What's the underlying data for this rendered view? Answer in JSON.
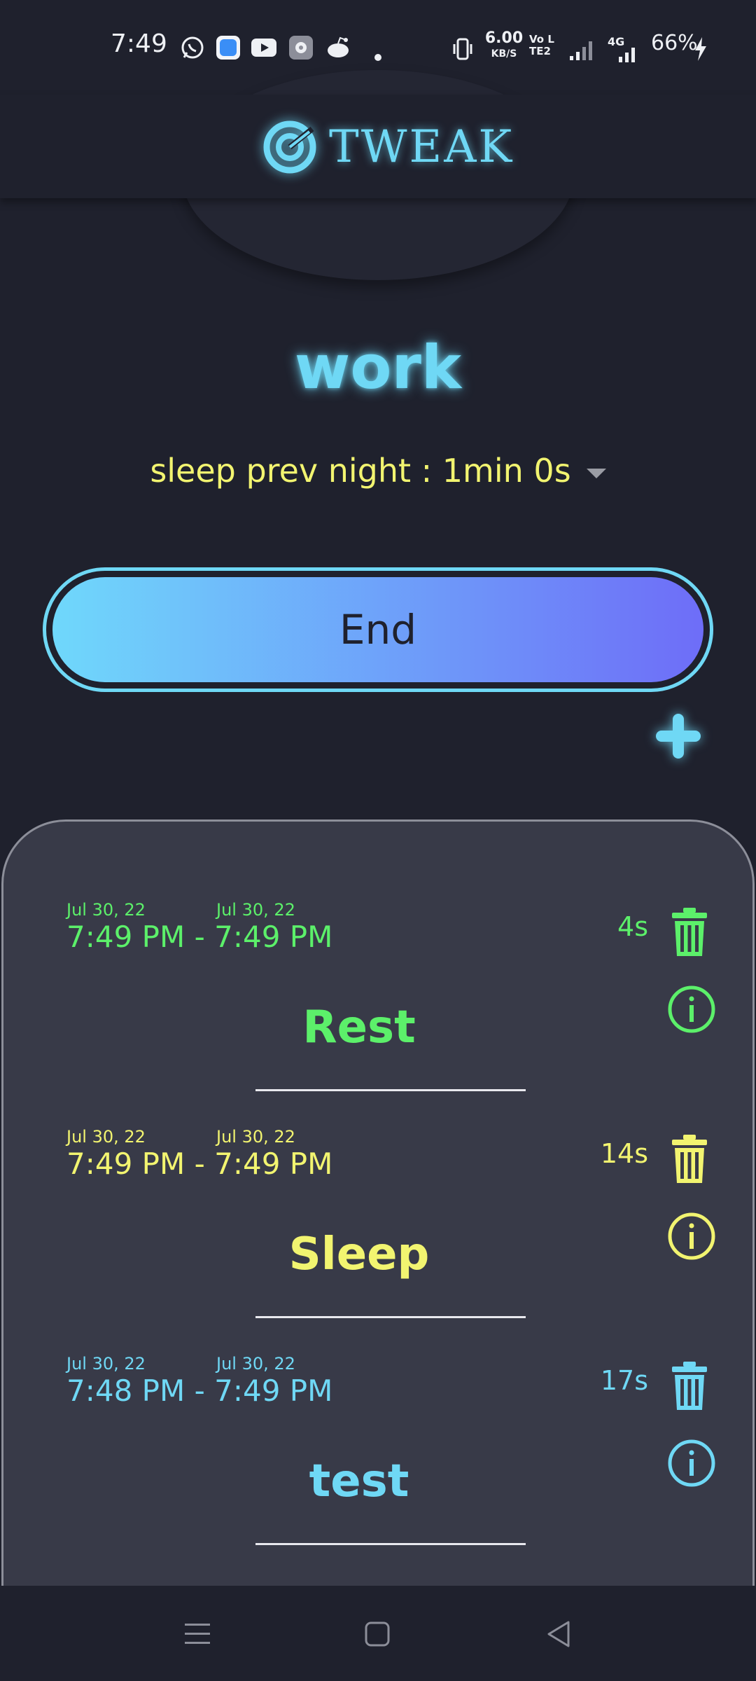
{
  "status_bar": {
    "time": "7:49",
    "net_speed": "6.00",
    "net_unit": "KB/S",
    "volte": "Vo LTE2",
    "signal_label": "4G",
    "battery": "66%",
    "notification_icons": [
      "whatsapp-icon",
      "files-icon",
      "youtube-icon",
      "settings-icon",
      "reddit-icon",
      "dot-icon"
    ]
  },
  "app": {
    "logo_text": "TWEAK",
    "accent": "#6fd8f5"
  },
  "current": {
    "activity": "work",
    "sleep_summary": "sleep prev night : 1min 0s",
    "end_label": "End"
  },
  "history": [
    {
      "start_date": "Jul 30, 22",
      "end_date": "Jul 30, 22",
      "start_time": "7:49 PM",
      "end_time": "7:49 PM",
      "separator": "-",
      "duration": "4s",
      "name": "Rest",
      "color": "#5cf06a"
    },
    {
      "start_date": "Jul 30, 22",
      "end_date": "Jul 30, 22",
      "start_time": "7:49 PM",
      "end_time": "7:49 PM",
      "separator": "-",
      "duration": "14s",
      "name": "Sleep",
      "color": "#f2f470"
    },
    {
      "start_date": "Jul 30, 22",
      "end_date": "Jul 30, 22",
      "start_time": "7:48 PM",
      "end_time": "7:49 PM",
      "separator": "-",
      "duration": "17s",
      "name": "test",
      "color": "#6fd8f5"
    }
  ],
  "nav": [
    "menu-icon",
    "home-icon",
    "back-icon"
  ]
}
